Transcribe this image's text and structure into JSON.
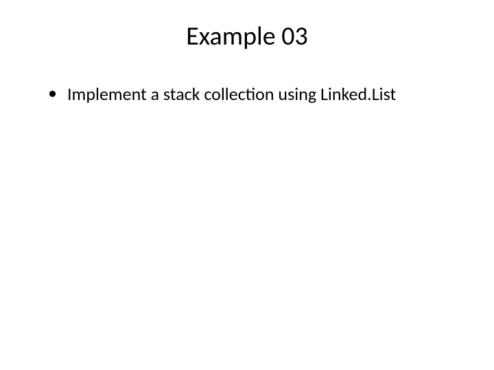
{
  "slide": {
    "title": "Example 03",
    "bullets": [
      "Implement a stack collection using Linked.List"
    ]
  }
}
